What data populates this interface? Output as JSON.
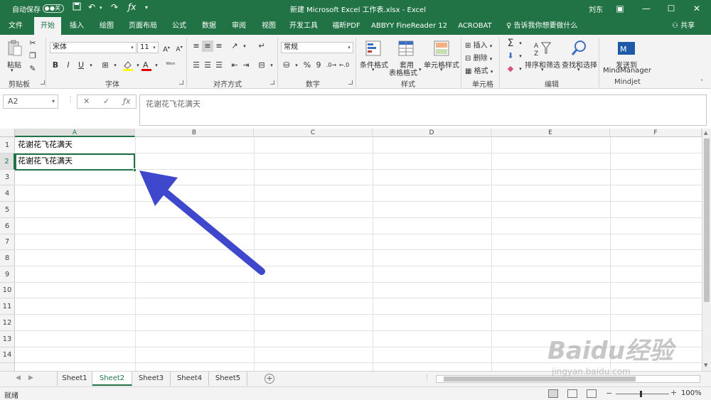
{
  "titlebar": {
    "autosave_label": "自动保存",
    "autosave_state": "●关",
    "doc_title": "新建 Microsoft Excel 工作表.xlsx  -  Excel",
    "user": "刘东"
  },
  "tabs": [
    "文件",
    "开始",
    "插入",
    "绘图",
    "页面布局",
    "公式",
    "数据",
    "审阅",
    "视图",
    "开发工具",
    "福昕PDF",
    "ABBYY FineReader 12",
    "ACROBAT"
  ],
  "active_tab": "开始",
  "tell_me": "告诉我你想要做什么",
  "share": "共享",
  "ribbon": {
    "clipboard": {
      "paste": "粘贴",
      "label": "剪贴板"
    },
    "font": {
      "name": "宋体",
      "size": "11",
      "bold": "B",
      "italic": "I",
      "underline": "U",
      "label": "字体"
    },
    "alignment": {
      "label": "对齐方式"
    },
    "number": {
      "format": "常规",
      "percent": "%",
      "comma": "9",
      "label": "数字"
    },
    "styles": {
      "conditional": "条件格式",
      "table_1": "套用",
      "table_2": "表格格式",
      "cell_styles": "单元格样式",
      "label": "样式"
    },
    "cells": {
      "insert": "插入",
      "delete": "删除",
      "format": "格式",
      "label": "单元格"
    },
    "editing": {
      "sort": "排序和筛选",
      "find": "查找和选择",
      "label": "编辑"
    },
    "mindjet": {
      "send_1": "发送到",
      "send_2": "MindManager",
      "label": "Mindjet"
    }
  },
  "formula_bar": {
    "name_box": "A2",
    "formula": "花谢花飞花满天"
  },
  "grid": {
    "columns": [
      "A",
      "B",
      "C",
      "D",
      "E",
      "F"
    ],
    "selected_column": "A",
    "rows": [
      "1",
      "2",
      "3",
      "4",
      "5",
      "6",
      "7",
      "8",
      "9",
      "10",
      "11",
      "12",
      "13",
      "14"
    ],
    "selected_row": "2",
    "cells": {
      "A1": "花谢花飞花满天",
      "A2": "花谢花飞花满天"
    }
  },
  "sheets": [
    "Sheet1",
    "Sheet2",
    "Sheet3",
    "Sheet4",
    "Sheet5"
  ],
  "active_sheet": "Sheet2",
  "status": {
    "ready": "就绪",
    "zoom": "100%"
  },
  "watermark": {
    "brand": "Baidu经验",
    "url": "jingyan.baidu.com"
  },
  "colors": {
    "accent": "#217346",
    "arrow": "#3f48cc"
  }
}
